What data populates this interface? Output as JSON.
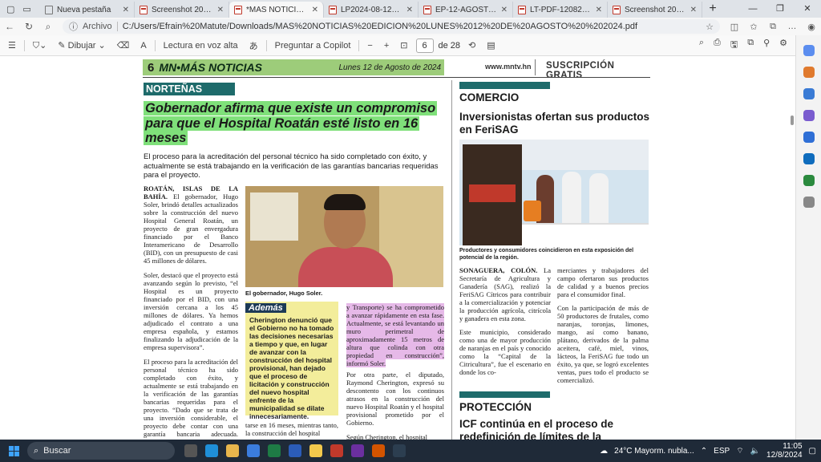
{
  "browser": {
    "tabs": [
      {
        "title": "Nueva pestaña",
        "type": "page"
      },
      {
        "title": "Screenshot 2024-08-1",
        "type": "pdf"
      },
      {
        "title": "*MAS NOTICIAS EDICI",
        "type": "pdf",
        "active": true
      },
      {
        "title": "LP2024-08-12-tnbpM",
        "type": "pdf"
      },
      {
        "title": "EP-12-AGOSTO-2024-",
        "type": "pdf"
      },
      {
        "title": "LT-PDF-12082024-HG",
        "type": "pdf"
      },
      {
        "title": "Screenshot 2024-08-1",
        "type": "pdf"
      }
    ],
    "new_tab": "+",
    "address": {
      "protocol": "Archivo",
      "url": "C:/Users/Efrain%20Matute/Downloads/MAS%20NOTICIAS%20EDICION%20LUNES%2012%20DE%20AGOSTO%20%202024.pdf"
    }
  },
  "pdf_toolbar": {
    "draw_label": "Dibujar",
    "read_aloud_label": "Lectura en voz alta",
    "ask_copilot_label": "Preguntar a Copilot",
    "current_page": "6",
    "page_total": "de 28"
  },
  "page": {
    "masthead": {
      "page_number": "6",
      "logo": "MN•MÁS NOTICIAS",
      "date": "Lunes 12 de Agosto de 2024",
      "site": "www.mntv.hn",
      "subscription": "SUSCRIPCIÓN GRATIS"
    },
    "left": {
      "section": "NORTEÑAS",
      "headline": "Gobernador afirma que existe un compromiso para que el Hospital Roatán esté listo en 16 meses",
      "deck": "El proceso para la acreditación del personal técnico ha sido completado con éxito, y actualmente se está trabajando en la verificación de las garantías bancarias requeridas para el proyecto.",
      "col1": [
        {
          "lead": "ROATÁN, ISLAS DE LA BAHÍA.",
          "text": " El gobernador, Hugo Soler, brindó detalles actualizados sobre la construcción del nuevo Hospital General Roatán, un proyecto de gran envergadura financiado por el Banco Interamericano de Desarrollo (BID), con un presupuesto de casi 45 millones de dólares."
        },
        {
          "lead": "",
          "text": "Soler, destacó que el proyecto está avanzando según lo previsto, “el Hospital es un proyecto financiado por el BID, con una inversión cercana a los 45 millones de dólares. Ya hemos adjudicado el contrato a una empresa española, y estamos finalizando la adjudicación de la empresa supervisora”."
        },
        {
          "lead": "",
          "text": "El proceso para la acreditación del personal técnico ha sido completado con éxito, y actualmente se está trabajando en la verificación de las garantías bancarias requeridas para el proyecto. “Dado que se trata de una inversión considerable, el proyecto debe contar con una garantía bancaria adecuada. Esperamos concluir este proceso en"
        }
      ],
      "photo_caption": "El gobernador, Hugo Soler.",
      "ademas": {
        "tag": "Además",
        "text": "Cherington denunció que el Gobierno no ha tomado las decisiones necesarias a tiempo y que, en lugar de avanzar con la construcción del hospital provisional, han dejado que el proceso de licitación y construcción del nuevo hospital enfrente de la municipalidad se dilate innecesariamente."
      },
      "col2_bottom": "tarse en 16 meses, mientras tanto, la construcción del hospital",
      "highlight": "y Transporte) se ha comprometido a avanzar rápidamente en esta fase. Actualmente, se está levantando un muro perimetral de aproximadamente 15 metros de altura que colinda con otra propiedad en construcción”, informó Soler.",
      "col3": [
        "Por otra parte, el diputado, Raymond Cherington, expresó su descontento con los continuos atrasos en la construcción del nuevo Hospital Roatán y el hospital provisional prometido por el Gobierno.",
        "Según Cherington, el hospital"
      ]
    },
    "right": {
      "section": "COMERCIO",
      "headline": "Inversionistas ofertan sus productos en FeriSAG",
      "photo_caption": "Productores y consumidores coincidieron en esta exposición del potencial de la región.",
      "col1": [
        {
          "lead": "SONAGUERA, COLÓN.",
          "text": " La Secretaría de Agricultura y Ganadería (SAG), realizó la FeriSAG Cítricos para contribuir a la comercialización y potenciar la producción agrícola, citrícola y ganadera en esta zona."
        },
        {
          "lead": "",
          "text": "Este municipio, considerado como una de mayor producción de naranjas en el país y conocido como la “Capital de la Citricultura”, fue el escenario en donde los co-"
        }
      ],
      "col2": [
        "merciantes y trabajadores del campo ofertaron sus productos de calidad y a buenos precios para el consumidor final.",
        "Con la participación de más de 50 productores de frutales, como naranjas, toronjas, limones, mango, así como banano, plátano, derivados de la palma aceitera, café, miel, vinos, lácteos, la FeriSAG fue todo un éxito, ya que, se logró excelentes ventas, pues todo el producto se comercializó."
      ],
      "section2": "PROTECCIÓN",
      "headline2": "ICF continúa en el proceso de redefinición de límites de la"
    }
  },
  "taskbar": {
    "search_placeholder": "Buscar",
    "weather": "24°C  Mayorm. nubla...",
    "lang": "ESP",
    "time": "11:05",
    "date": "12/8/2024"
  },
  "colors": {
    "accent_green": "#7fe07a",
    "section_teal": "#1e6b6b",
    "highlight_pink": "#e6b9e8",
    "box_yellow": "#f3ed9b",
    "taskbar": "#1f2a38"
  }
}
